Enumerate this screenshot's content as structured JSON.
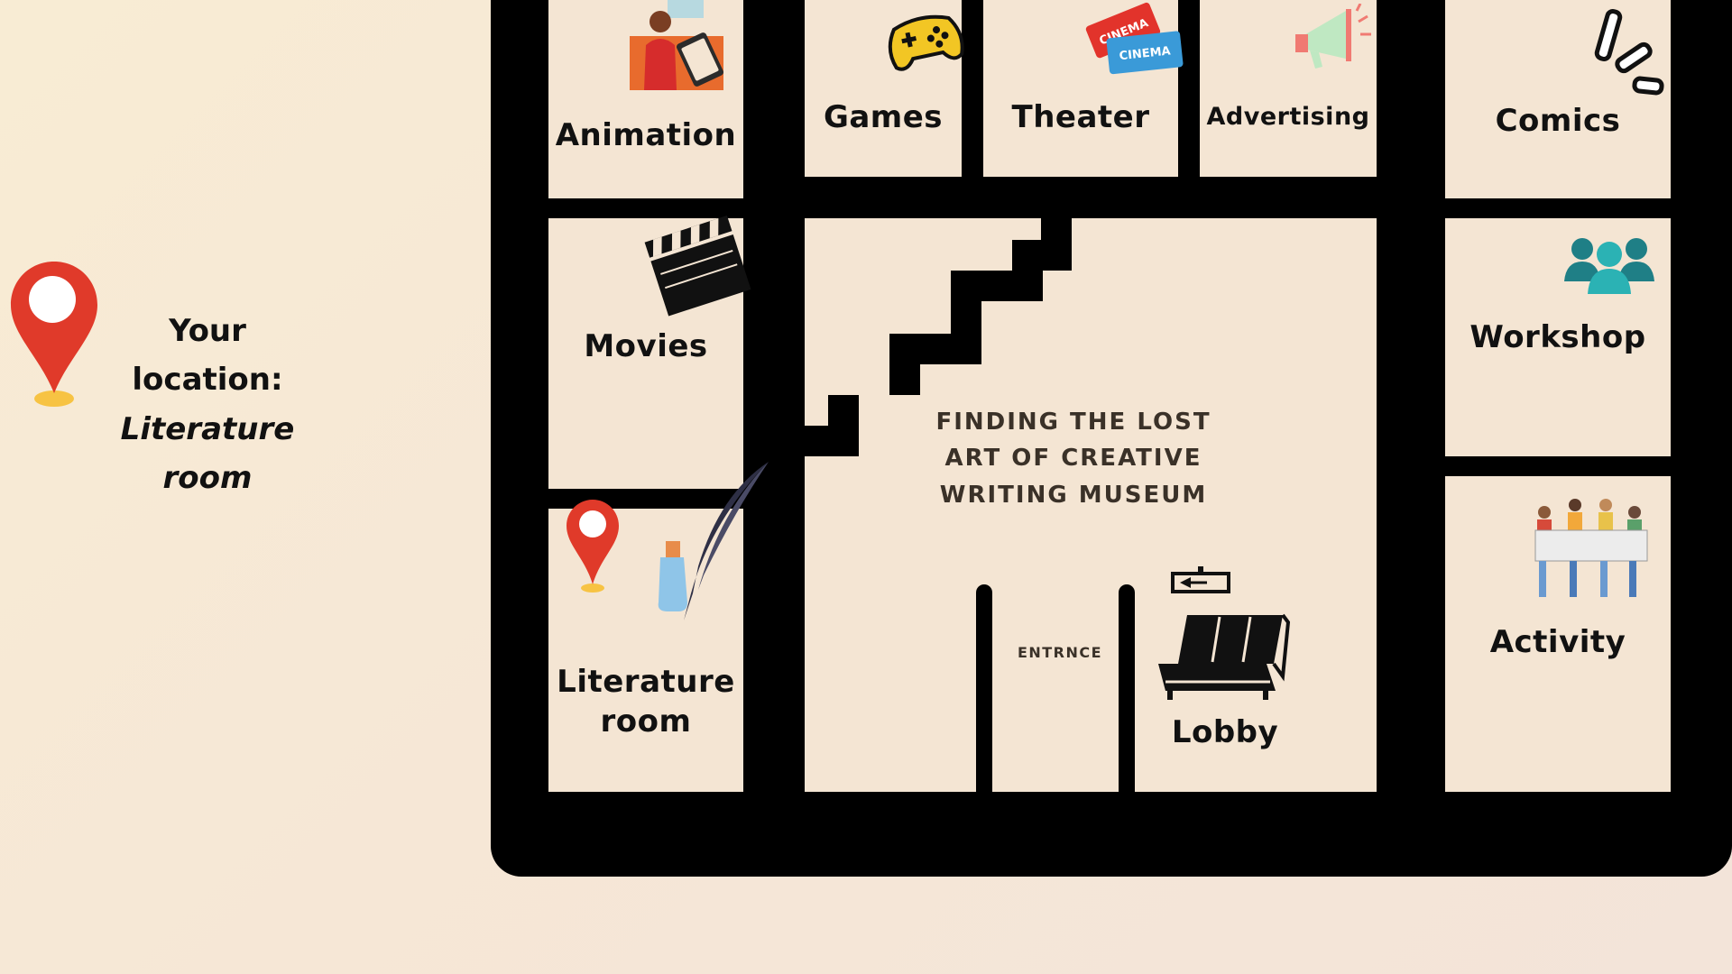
{
  "location": {
    "label_line1": "Your",
    "label_line2": "location:",
    "room_line1": "Literature",
    "room_line2": "room"
  },
  "museum": {
    "title_line1": "FINDING THE LOST",
    "title_line2": "ART OF CREATIVE",
    "title_line3": "WRITING MUSEUM",
    "entrance": "ENTRNCE"
  },
  "rooms": {
    "animation": "Animation",
    "games": "Games",
    "theater": "Theater",
    "advertising": "Advertising",
    "comics": "Comics",
    "movies": "Movies",
    "workshop": "Workshop",
    "literature_line1": "Literature",
    "literature_line2": "room",
    "activity": "Activity",
    "lobby": "Lobby"
  },
  "icons": {
    "animation": "animator-at-tablet-icon",
    "games": "game-controller-icon",
    "theater": "cinema-tickets-icon",
    "advertising": "megaphone-icon",
    "comics": "exclamation-burst-icon",
    "movies": "clapperboard-icon",
    "workshop": "people-group-icon",
    "literature": "quill-and-ink-icon",
    "activity": "protest-crowd-icon",
    "lobby": "lobby-sofa-icon",
    "current_location": "map-pin-icon"
  },
  "colors": {
    "background": "#f6e7d6",
    "room": "#f4e5d3",
    "wall": "#000000",
    "pin": "#e03a2a",
    "pin_base": "#f7c343",
    "title_text": "#3a3128"
  }
}
